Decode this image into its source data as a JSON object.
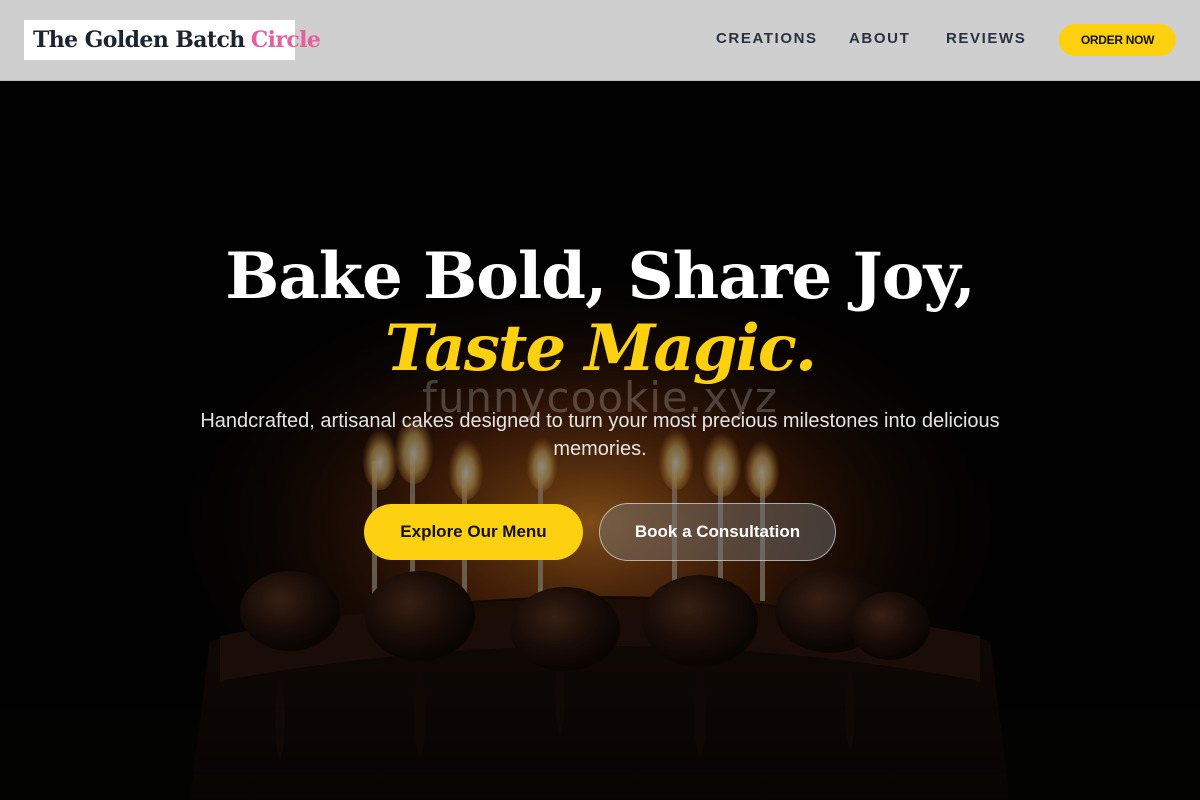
{
  "header": {
    "logo": {
      "main": "The Golden Batch",
      "accent": "Circle"
    },
    "nav": [
      {
        "label": "CREATIONS"
      },
      {
        "label": "ABOUT"
      },
      {
        "label": "REVIEWS"
      }
    ],
    "order_button": "ORDER NOW"
  },
  "hero": {
    "headline_line1": "Bake Bold, Share Joy,",
    "headline_line2": "Taste Magic.",
    "watermark": "funnycookie.xyz",
    "subtitle": "Handcrafted, artisanal cakes designed to turn your most precious milestones into delicious memories.",
    "primary_button": "Explore Our Menu",
    "secondary_button": "Book a Consultation",
    "background_image": "dark-chocolate-birthday-cake-with-lit-candles"
  },
  "colors": {
    "accent_yellow": "#fdd10f",
    "logo_pink": "#e6609e",
    "header_bg": "#cfcfcf",
    "nav_text": "#2a3140",
    "hero_bg": "#000000"
  }
}
